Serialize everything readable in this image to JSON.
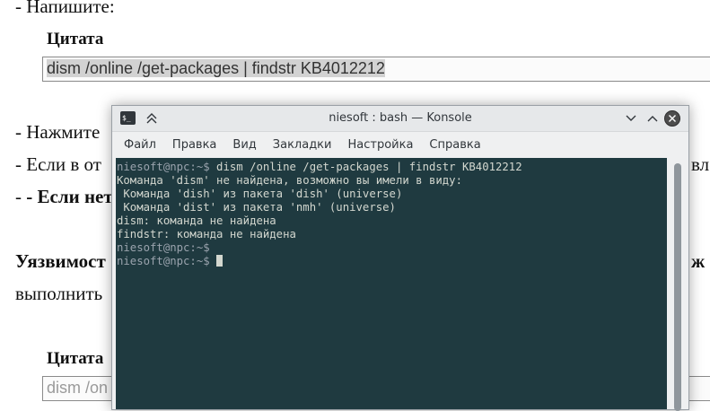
{
  "page": {
    "line1": "- Напишите:",
    "quote1_label": "Цитата",
    "quote1_text": "dism /online /get-packages | findstr KB4012212",
    "line_press": "- Нажмите",
    "line_if": "- Если в от",
    "line_if_right": "вле",
    "line_ifnot": "- Если нет,",
    "vuln": "Уязвимост",
    "vuln_right": "ж",
    "execute": "выполнить",
    "quote2_label": "Цитата",
    "quote2_text": "dism /on"
  },
  "window": {
    "title": "niesoft : bash — Konsole",
    "app_icon_glyph": "$_",
    "pin_icon": "keep-above-icon",
    "minimize_icon": "chevron-down-icon",
    "maximize_icon": "chevron-up-icon",
    "close_icon": "close-icon"
  },
  "menu": [
    "Файл",
    "Правка",
    "Вид",
    "Закладки",
    "Настройка",
    "Справка"
  ],
  "terminal": {
    "lines": [
      {
        "prompt": "niesoft@npc:~$",
        "text": " dism /online /get-packages | findstr KB4012212"
      },
      {
        "prompt": "",
        "text": "Команда 'dism' не найдена, возможно вы имели в виду:"
      },
      {
        "prompt": "",
        "text": " Команда 'dish' из пакета 'dish' (universe)"
      },
      {
        "prompt": "",
        "text": " Команда 'dist' из пакета 'nmh' (universe)"
      },
      {
        "prompt": "",
        "text": "dism: команда не найдена"
      },
      {
        "prompt": "",
        "text": "findstr: команда не найдена"
      },
      {
        "prompt": "niesoft@npc:~$",
        "text": ""
      },
      {
        "prompt": "niesoft@npc:~$",
        "text": " "
      }
    ]
  },
  "colors": {
    "terminal_bg": "#1f3a40",
    "terminal_fg": "#d3d7cf",
    "prompt": "#9aa3ad"
  }
}
